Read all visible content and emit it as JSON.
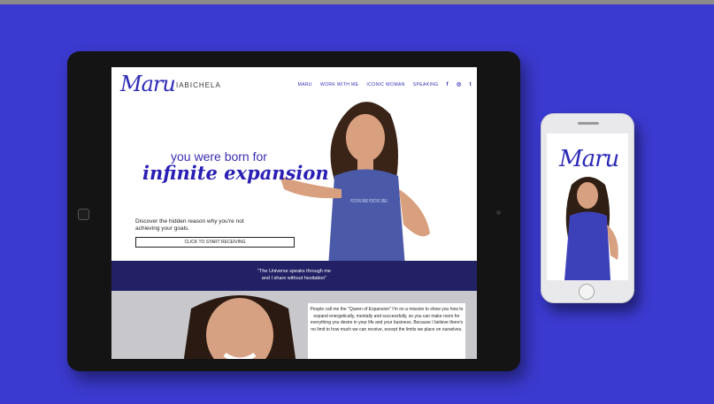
{
  "site": {
    "logo_script": "Maru",
    "logo_surname": "IABICHELA",
    "nav": [
      "MARU",
      "WORK WITH ME",
      "ICONIC WOMAN",
      "SPEAKING"
    ],
    "social_icons": [
      "facebook-icon",
      "instagram-icon",
      "twitter-icon"
    ],
    "social_glyphs": [
      "f",
      "◎",
      "t"
    ]
  },
  "hero": {
    "line1": "you were born for",
    "line2": "infinite expansion",
    "discover": "Discover the hidden reason why you're not achieving your goals.",
    "cta_label": "CLICK TO START RECEIVING"
  },
  "shirt_text": "POSITIVE MIND POSITIVE VIBES",
  "band": {
    "quote_line1": "\"The Universe speaks through me",
    "quote_line2": "and I share without hesitation\""
  },
  "about": {
    "text": "People call me the \"Queen of Expansion\" I'm on a mission to show you how to expand energetically, mentally and successfully, so you can make room for everything you desire in your life and your business. Because I believe there's no limit to how much we can receive, except the limits we place on ourselves."
  },
  "phone": {
    "logo_script": "Maru"
  },
  "colors": {
    "background": "#3b3ad0",
    "brand": "#2d2bb7",
    "band": "#222166"
  }
}
